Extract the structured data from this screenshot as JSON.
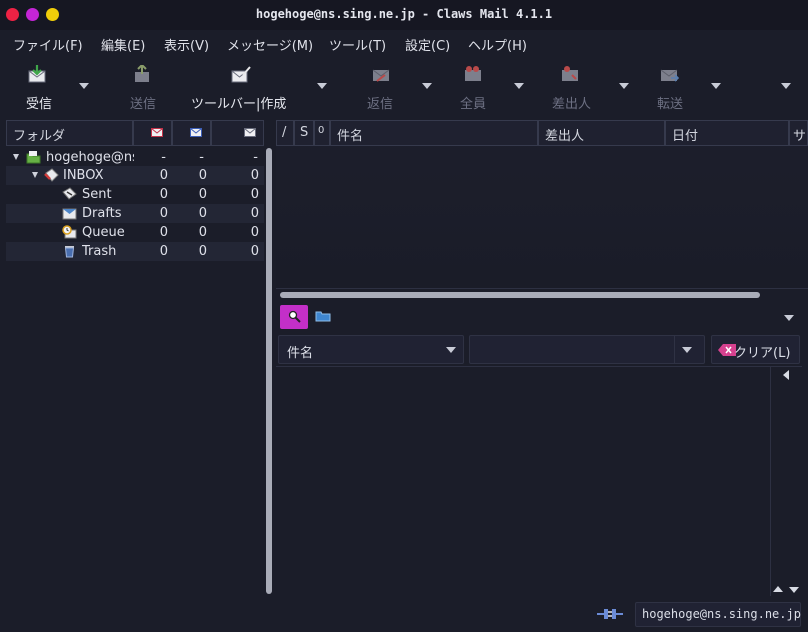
{
  "window": {
    "title": "hogehoge@ns.sing.ne.jp - Claws Mail 4.1.1",
    "controls": [
      "close",
      "minimize",
      "maximize"
    ]
  },
  "menubar": {
    "items": [
      {
        "label": "ファイル(F)"
      },
      {
        "label": "編集(E)"
      },
      {
        "label": "表示(V)"
      },
      {
        "label": "メッセージ(M)"
      },
      {
        "label": "ツール(T)"
      },
      {
        "label": "設定(C)"
      },
      {
        "label": "ヘルプ(H)"
      }
    ]
  },
  "toolbar": {
    "receive_label": "受信",
    "send_label": "送信",
    "compose_label": "ツールバー|作成",
    "reply_label": "返信",
    "reply_all_label": "全員",
    "reply_sender_label": "差出人",
    "forward_label": "転送"
  },
  "folder_pane": {
    "header": {
      "label": "フォルダ"
    },
    "tree": [
      {
        "name": "hogehoge@ns",
        "new": "-",
        "unread": "-",
        "total": "-",
        "icon": "mailbox-icon"
      },
      {
        "name": "INBOX",
        "new": "0",
        "unread": "0",
        "total": "0",
        "icon": "inbox-icon"
      },
      {
        "name": "Sent",
        "new": "0",
        "unread": "0",
        "total": "0",
        "icon": "sent-icon"
      },
      {
        "name": "Drafts",
        "new": "0",
        "unread": "0",
        "total": "0",
        "icon": "drafts-icon"
      },
      {
        "name": "Queue",
        "new": "0",
        "unread": "0",
        "total": "0",
        "icon": "queue-icon"
      },
      {
        "name": "Trash",
        "new": "0",
        "unread": "0",
        "total": "0",
        "icon": "trash-icon"
      }
    ]
  },
  "message_list": {
    "columns": {
      "mark": "/",
      "status": "S",
      "attach": "0",
      "subject": "件名",
      "from": "差出人",
      "date": "日付",
      "size": "サ"
    }
  },
  "quick_search": {
    "type_selected": "件名",
    "search_value": "",
    "clear_label": "クリア(L)"
  },
  "statusbar": {
    "account": "hogehoge@ns.sing.ne.jp"
  },
  "colors": {
    "background": "#1b1d29",
    "accent_magenta": "#c32fc8",
    "close": "#ee2244",
    "minimize": "#c425d6",
    "maximize": "#f0cd0a"
  }
}
